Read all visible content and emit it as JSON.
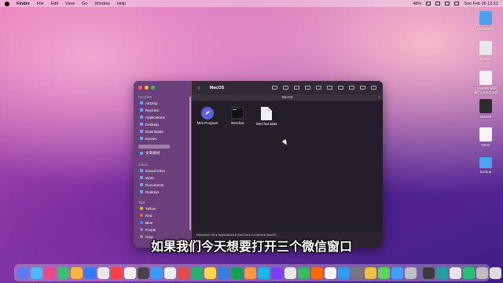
{
  "menubar": {
    "app_name": "Finder",
    "menus": [
      "File",
      "Edit",
      "View",
      "Go",
      "Window",
      "Help"
    ],
    "battery": "48%",
    "clock": "Sun Feb 26  12:12"
  },
  "desktop_icons": [
    {
      "label": "Documents",
      "icon": "folder-icon",
      "color": "#4aa3f0"
    },
    {
      "label": "Images",
      "icon": "image-folder-icon",
      "color": "#e8e8e8"
    },
    {
      "label": "ChatGPT 研究报告(2023).pdf",
      "icon": "pdf-icon",
      "color": "#f2f2f2"
    },
    {
      "label": "Movies",
      "icon": "movie-folder-icon",
      "color": "#2b2b2b"
    },
    {
      "label": "Other",
      "icon": "installer-icon",
      "color": "#f5f5f5"
    },
    {
      "label": "backup",
      "icon": "folder-icon",
      "color": "#4aa3f0"
    }
  ],
  "finder": {
    "title": "MacOS",
    "tab_title": "MacOS",
    "sidebar": {
      "favorites_header": "Favorites",
      "favorites": [
        "AirDrop",
        "Recents",
        "Applications",
        "Desktop",
        "Downloads",
        "Movies",
        "文章素材"
      ],
      "icloud_header": "iCloud",
      "icloud": [
        "iCloud Drive",
        "Work",
        "Documents",
        "Desktop"
      ],
      "tags_header": "Tags",
      "tags": [
        {
          "label": "Yellow",
          "color": "#f5c400"
        },
        {
          "label": "Red",
          "color": "#ff4d4d"
        },
        {
          "label": "Blue",
          "color": "#3a8dff"
        },
        {
          "label": "Purple",
          "color": "#b06bff"
        },
        {
          "label": "Gray",
          "color": "#9a9a9a"
        }
      ]
    },
    "files": [
      {
        "name": "Mini Program",
        "icon": "mini-program-icon"
      },
      {
        "name": "WeChat",
        "icon": "terminal-script-icon"
      },
      {
        "name": "WeChat alias",
        "icon": "document-icon"
      }
    ],
    "path": "Macintosh HD ▸ Applications ▸ WeChat ▸ Contents ▸ MacOS"
  },
  "subtitle": "如果我们今天想要打开三个微信窗口",
  "dock_colors": [
    "#5a7cf0",
    "#4bb8ff",
    "#e84b8a",
    "#38c172",
    "#ffb340",
    "#2e7bff",
    "#e8e8e8",
    "#ff4040",
    "#f0f0f0",
    "#444",
    "#3a9bff",
    "#eee",
    "#e24a4a",
    "#22b46b",
    "#ffd84a",
    "#2f7fe0",
    "#12a150",
    "#ff9a3c",
    "#1ab8e8",
    "#7d3cff",
    "#e8e8e8",
    "#30c060",
    "#ff6a00",
    "#f5f5f5",
    "#2e9cf0",
    "#777",
    "#f0c040",
    "#5bd55b",
    "#40a0ff",
    "#c0c0c0",
    "#3b3b3b",
    "#20a0a0",
    "#e5e5e5",
    "#22c36f",
    "#bdbdbd",
    "#ddd"
  ]
}
